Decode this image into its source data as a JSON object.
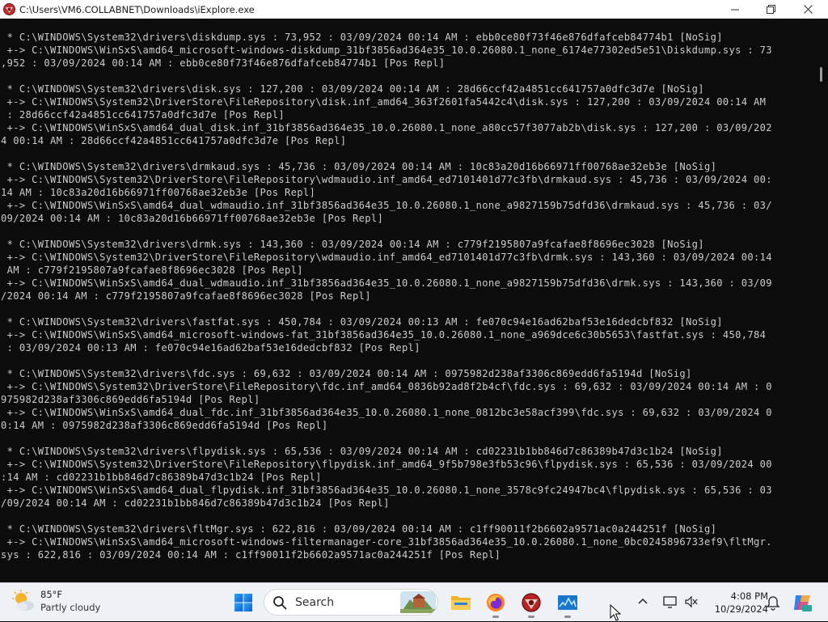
{
  "window": {
    "title": "C:\\Users\\VM6.COLLABNET\\Downloads\\iExplore.exe"
  },
  "console": {
    "lines": [
      " * C:\\WINDOWS\\System32\\drivers\\diskdump.sys : 73,952 : 03/09/2024 00:14 AM : ebb0ce80f73f46e876dfafceb84774b1 [NoSig]",
      " +-> C:\\WINDOWS\\WinSxS\\amd64_microsoft-windows-diskdump_31bf3856ad364e35_10.0.26080.1_none_6174e77302ed5e51\\Diskdump.sys : 73",
      ",952 : 03/09/2024 00:14 AM : ebb0ce80f73f46e876dfafceb84774b1 [Pos Repl]",
      "",
      " * C:\\WINDOWS\\System32\\drivers\\disk.sys : 127,200 : 03/09/2024 00:14 AM : 28d66ccf42a4851cc641757a0dfc3d7e [NoSig]",
      " +-> C:\\WINDOWS\\System32\\DriverStore\\FileRepository\\disk.inf_amd64_363f2601fa5442c4\\disk.sys : 127,200 : 03/09/2024 00:14 AM",
      " : 28d66ccf42a4851cc641757a0dfc3d7e [Pos Repl]",
      " +-> C:\\WINDOWS\\WinSxS\\amd64_dual_disk.inf_31bf3856ad364e35_10.0.26080.1_none_a80cc57f3077ab2b\\disk.sys : 127,200 : 03/09/202",
      "4 00:14 AM : 28d66ccf42a4851cc641757a0dfc3d7e [Pos Repl]",
      "",
      " * C:\\WINDOWS\\System32\\drivers\\drmkaud.sys : 45,736 : 03/09/2024 00:14 AM : 10c83a20d16b66971ff00768ae32eb3e [NoSig]",
      " +-> C:\\WINDOWS\\System32\\DriverStore\\FileRepository\\wdmaudio.inf_amd64_ed7101401d77c3fb\\drmkaud.sys : 45,736 : 03/09/2024 00:",
      "14 AM : 10c83a20d16b66971ff00768ae32eb3e [Pos Repl]",
      " +-> C:\\WINDOWS\\WinSxS\\amd64_dual_wdmaudio.inf_31bf3856ad364e35_10.0.26080.1_none_a9827159b75dfd36\\drmkaud.sys : 45,736 : 03/",
      "09/2024 00:14 AM : 10c83a20d16b66971ff00768ae32eb3e [Pos Repl]",
      "",
      " * C:\\WINDOWS\\System32\\drivers\\drmk.sys : 143,360 : 03/09/2024 00:14 AM : c779f2195807a9fcafae8f8696ec3028 [NoSig]",
      " +-> C:\\WINDOWS\\System32\\DriverStore\\FileRepository\\wdmaudio.inf_amd64_ed7101401d77c3fb\\drmk.sys : 143,360 : 03/09/2024 00:14",
      " AM : c779f2195807a9fcafae8f8696ec3028 [Pos Repl]",
      " +-> C:\\WINDOWS\\WinSxS\\amd64_dual_wdmaudio.inf_31bf3856ad364e35_10.0.26080.1_none_a9827159b75dfd36\\drmk.sys : 143,360 : 03/09",
      "/2024 00:14 AM : c779f2195807a9fcafae8f8696ec3028 [Pos Repl]",
      "",
      " * C:\\WINDOWS\\System32\\drivers\\fastfat.sys : 450,784 : 03/09/2024 00:13 AM : fe070c94e16ad62baf53e16dedcbf832 [NoSig]",
      " +-> C:\\WINDOWS\\WinSxS\\amd64_microsoft-windows-fat_31bf3856ad364e35_10.0.26080.1_none_a969dce6c30b5653\\fastfat.sys : 450,784",
      " : 03/09/2024 00:13 AM : fe070c94e16ad62baf53e16dedcbf832 [Pos Repl]",
      "",
      " * C:\\WINDOWS\\System32\\drivers\\fdc.sys : 69,632 : 03/09/2024 00:14 AM : 0975982d238af3306c869edd6fa5194d [NoSig]",
      " +-> C:\\WINDOWS\\System32\\DriverStore\\FileRepository\\fdc.inf_amd64_0836b92ad8f2b4cf\\fdc.sys : 69,632 : 03/09/2024 00:14 AM : 0",
      "975982d238af3306c869edd6fa5194d [Pos Repl]",
      " +-> C:\\WINDOWS\\WinSxS\\amd64_dual_fdc.inf_31bf3856ad364e35_10.0.26080.1_none_0812bc3e58acf399\\fdc.sys : 69,632 : 03/09/2024 0",
      "0:14 AM : 0975982d238af3306c869edd6fa5194d [Pos Repl]",
      "",
      " * C:\\WINDOWS\\System32\\drivers\\flpydisk.sys : 65,536 : 03/09/2024 00:14 AM : cd02231b1bb846d7c86389b47d3c1b24 [NoSig]",
      " +-> C:\\WINDOWS\\System32\\DriverStore\\FileRepository\\flpydisk.inf_amd64_9f5b798e3fb53c96\\flpydisk.sys : 65,536 : 03/09/2024 00",
      ":14 AM : cd02231b1bb846d7c86389b47d3c1b24 [Pos Repl]",
      " +-> C:\\WINDOWS\\WinSxS\\amd64_dual_flpydisk.inf_31bf3856ad364e35_10.0.26080.1_none_3578c9fc24947bc4\\flpydisk.sys : 65,536 : 03",
      "/09/2024 00:14 AM : cd02231b1bb846d7c86389b47d3c1b24 [Pos Repl]",
      "",
      " * C:\\WINDOWS\\System32\\drivers\\fltMgr.sys : 622,816 : 03/09/2024 00:14 AM : c1ff90011f2b6602a9571ac0a244251f [NoSig]",
      " +-> C:\\WINDOWS\\WinSxS\\amd64_microsoft-windows-filtermanager-core_31bf3856ad364e35_10.0.26080.1_none_0bc0245896733ef9\\fltMgr.",
      "sys : 622,816 : 03/09/2024 00:14 AM : c1ff90011f2b6602a9571ac0a244251f [Pos Repl]"
    ]
  },
  "taskbar": {
    "weather": {
      "temp": "85°F",
      "condition": "Partly cloudy",
      "icon": "partly-cloudy-icon"
    },
    "search": {
      "placeholder": "Search",
      "icon": "search-icon"
    },
    "apps": [
      {
        "name": "start-button"
      },
      {
        "name": "file-explorer"
      },
      {
        "name": "firefox"
      },
      {
        "name": "iexplore-console"
      },
      {
        "name": "task-manager-monitor"
      }
    ],
    "tray": {
      "time": "4:08 PM",
      "date": "10/29/2024"
    }
  },
  "colors": {
    "console_bg": "#0c0c0c",
    "console_fg": "#cccccc",
    "taskbar_bg": "#eef1f6",
    "accent": "#0067c0"
  }
}
